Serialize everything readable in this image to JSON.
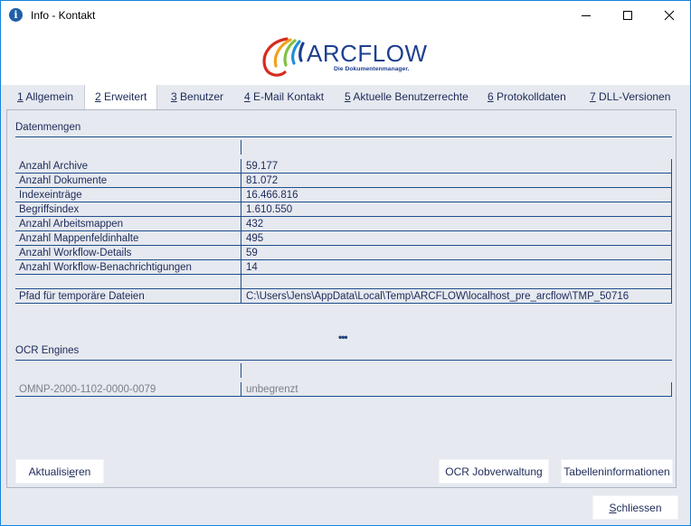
{
  "window": {
    "title": "Info - Kontakt",
    "icon": "info-icon",
    "controls": [
      "minimize-icon",
      "maximize-icon",
      "close-icon"
    ]
  },
  "logo": {
    "brand": "ARCFLOW",
    "tagline": "Die Dokumentenmanager.",
    "colors": [
      "#d62b1f",
      "#f0a21a",
      "#7fc241",
      "#1f8fd6",
      "#1f3f8f"
    ]
  },
  "tabs": [
    {
      "mnemonic": "1",
      "label": " Allgemein",
      "active": false
    },
    {
      "mnemonic": "2",
      "label": " Erweitert",
      "active": true
    },
    {
      "mnemonic": "3",
      "label": " Benutzer",
      "active": false
    },
    {
      "mnemonic": "4",
      "label": " E-Mail Kontakt",
      "active": false
    },
    {
      "mnemonic": "5",
      "label": " Aktuelle Benutzerrechte",
      "active": false
    },
    {
      "mnemonic": "6",
      "label": " Protokolldaten",
      "active": false
    },
    {
      "mnemonic": "7",
      "label": " DLL-Versionen",
      "active": false
    }
  ],
  "datenmengen": {
    "title": "Datenmengen",
    "rows": [
      {
        "label": "Anzahl Archive",
        "value": "59.177"
      },
      {
        "label": "Anzahl Dokumente",
        "value": "81.072"
      },
      {
        "label": "Indexeinträge",
        "value": "16.466.816"
      },
      {
        "label": "Begriffsindex",
        "value": "1.610.550"
      },
      {
        "label": "Anzahl Arbeitsmappen",
        "value": "432"
      },
      {
        "label": "Anzahl Mappenfeldinhalte",
        "value": "495"
      },
      {
        "label": "Anzahl Workflow-Details",
        "value": "59"
      },
      {
        "label": "Anzahl Workflow-Benachrichtigungen",
        "value": "14"
      }
    ],
    "path_label": "Pfad für temporäre Dateien",
    "path_value": "C:\\Users\\Jens\\AppData\\Local\\Temp\\ARCFLOW\\localhost_pre_arcflow\\TMP_50716"
  },
  "ellipsis": "•••",
  "ocr": {
    "title": "OCR Engines",
    "rows": [
      {
        "label": "OMNP-2000-1102-0000-0079",
        "value": "unbegrenzt"
      }
    ]
  },
  "buttons": {
    "refresh_pre": "Aktualisi",
    "refresh_mn": "e",
    "refresh_post": "ren",
    "ocr_jobs": "OCR Jobverwaltung",
    "table_info": "Tabelleninformationen",
    "close_mn": "S",
    "close_post": "chliessen"
  }
}
